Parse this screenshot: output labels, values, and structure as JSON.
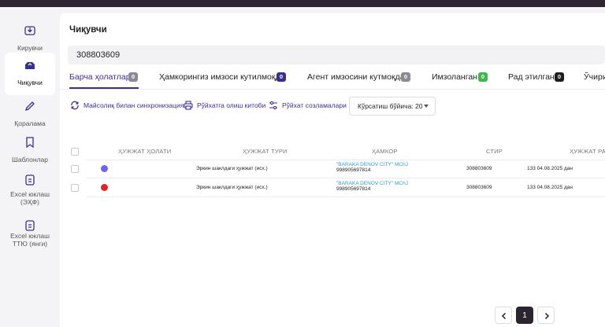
{
  "sidebar": {
    "items": [
      {
        "label": "Кирувчи",
        "icon": "inbox-icon",
        "active": false
      },
      {
        "label": "Чиқувчи",
        "icon": "outbox-icon",
        "active": true
      },
      {
        "label": "Қоралама",
        "icon": "pen-icon",
        "active": false
      },
      {
        "label": "Шаблонлар",
        "icon": "template-icon",
        "active": false
      },
      {
        "label_line1": "Excel юклаш",
        "label_line2": "(ЭҲФ)",
        "icon": "excel-upload-icon",
        "active": false
      },
      {
        "label_line1": "Excel юклаш",
        "label_line2": "ТТЮ (янги)",
        "icon": "excel-upload-new-icon",
        "active": false
      }
    ]
  },
  "page": {
    "title": "Чиқувчи",
    "search_value": "308803609"
  },
  "tabs": [
    {
      "label": "Барча ҳолатлар",
      "count": "0",
      "badge_color": "#8a8a93"
    },
    {
      "label": "Ҳамкорингиз имзоси кутилмоқда",
      "count": "0",
      "badge_color": "#3a2f8f"
    },
    {
      "label": "Агент имзосини кутмоқда",
      "count": "0",
      "badge_color": "#8a8a93"
    },
    {
      "label": "Имзоланган",
      "count": "0",
      "badge_color": "#3cb94a"
    },
    {
      "label": "Рад этилган",
      "count": "0",
      "badge_color": "#1e1e1e"
    },
    {
      "label": "Ўчири"
    }
  ],
  "toolbar": {
    "sync_label": "Майсолиқ билан синхронизация",
    "print_label": "Рўйхатга олиш китоби",
    "settings_label": "Рўйхат созламалари",
    "page_size_label": "Кўрсатиш бўйича: 20"
  },
  "table": {
    "headers": [
      "Ҳужжат ҳолати",
      "Ҳужжат тури",
      "Ҳамкор",
      "СТИР",
      "Ҳужжат ра"
    ],
    "rows": [
      {
        "status_color": "#6a64f0",
        "doc_type": "Эркин шаклдаги ҳужжат (исх.)",
        "partner_name": "\"BARAKA DENOV CITY\" MChJ",
        "partner_phone": "998905697814",
        "stir": "308803609",
        "doc_number": "133 04.08.2025 дан"
      },
      {
        "status_color": "#e02424",
        "doc_type": "Эркин шаклдаги ҳужжат (исх.)",
        "partner_name": "\"BARAKA DENOV CITY\" MChJ",
        "partner_phone": "998905697814",
        "stir": "308803609",
        "doc_number": "133 04.08.2025 дан"
      }
    ]
  },
  "pagination": {
    "current_page": "1"
  }
}
